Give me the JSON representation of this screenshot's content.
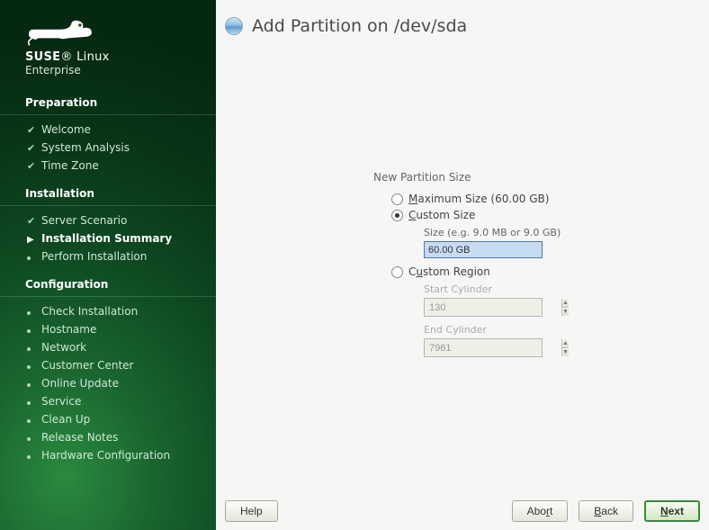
{
  "brand": {
    "name": "SUSE",
    "sub": "Linux",
    "line2": "Enterprise"
  },
  "sidebar": {
    "sections": [
      {
        "title": "Preparation",
        "items": [
          {
            "label": "Welcome",
            "state": "done"
          },
          {
            "label": "System Analysis",
            "state": "done"
          },
          {
            "label": "Time Zone",
            "state": "done"
          }
        ]
      },
      {
        "title": "Installation",
        "items": [
          {
            "label": "Server Scenario",
            "state": "done"
          },
          {
            "label": "Installation Summary",
            "state": "active"
          },
          {
            "label": "Perform Installation",
            "state": "pending"
          }
        ]
      },
      {
        "title": "Configuration",
        "items": [
          {
            "label": "Check Installation",
            "state": "pending"
          },
          {
            "label": "Hostname",
            "state": "pending"
          },
          {
            "label": "Network",
            "state": "pending"
          },
          {
            "label": "Customer Center",
            "state": "pending"
          },
          {
            "label": "Online Update",
            "state": "pending"
          },
          {
            "label": "Service",
            "state": "pending"
          },
          {
            "label": "Clean Up",
            "state": "pending"
          },
          {
            "label": "Release Notes",
            "state": "pending"
          },
          {
            "label": "Hardware Configuration",
            "state": "pending"
          }
        ]
      }
    ]
  },
  "page": {
    "title": "Add Partition on /dev/sda",
    "group_label": "New Partition Size",
    "options": {
      "max": {
        "prefix": "M",
        "rest": "aximum Size (60.00 GB)",
        "selected": false
      },
      "custom": {
        "prefix": "C",
        "rest": "ustom Size",
        "selected": true,
        "size_label": "Size (e.g. 9.0 MB or 9.0 GB)",
        "size_value": "60.00 GB"
      },
      "region": {
        "prefix": "C",
        "pre2": "u",
        "rest": "stom Region",
        "selected": false,
        "start_label": "Start Cylinder",
        "start_value": "130",
        "end_label": "End Cylinder",
        "end_value": "7961"
      }
    }
  },
  "buttons": {
    "help": "Help",
    "abort": {
      "pre": "Abo",
      "ul": "r",
      "post": "t"
    },
    "back": {
      "ul": "B",
      "post": "ack"
    },
    "next": {
      "ul": "N",
      "post": "ext"
    }
  }
}
